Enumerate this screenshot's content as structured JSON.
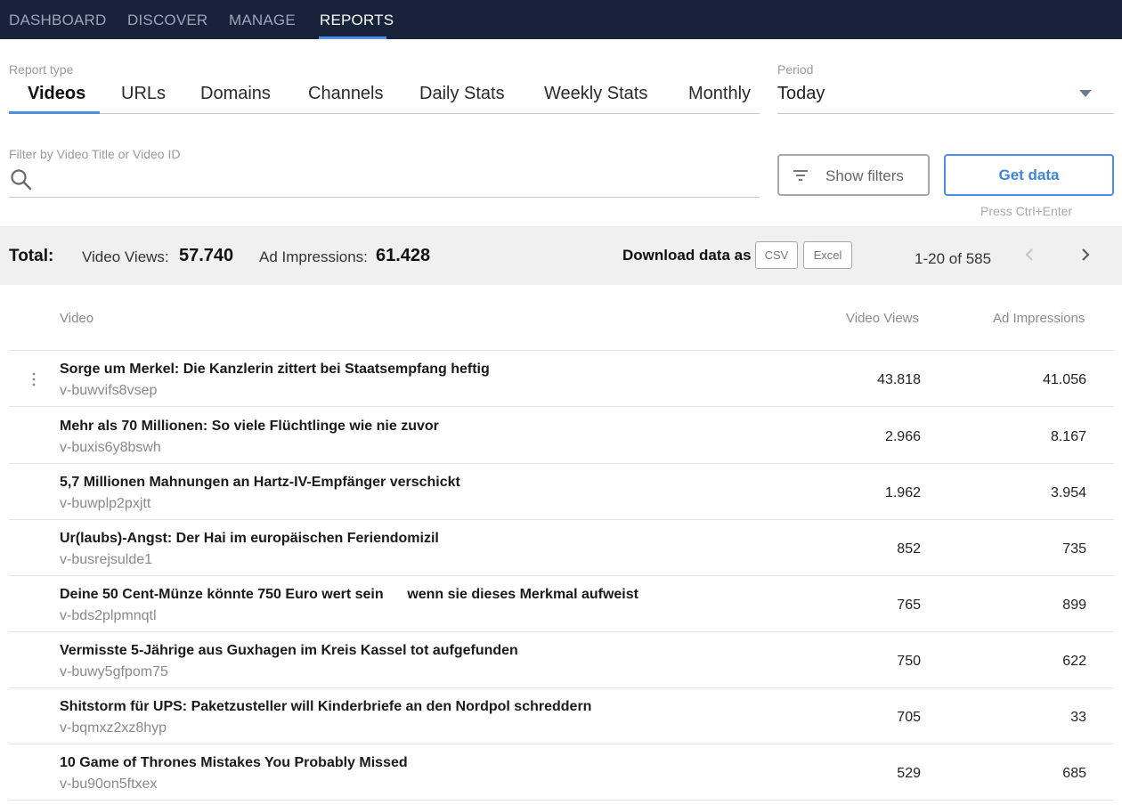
{
  "nav": {
    "items": [
      {
        "label": "DASHBOARD"
      },
      {
        "label": "DISCOVER"
      },
      {
        "label": "MANAGE"
      },
      {
        "label": "REPORTS"
      }
    ],
    "active": "REPORTS",
    "background": "#16233a",
    "accent": "#4a90e2"
  },
  "report_type": {
    "label": "Report type",
    "tabs": [
      {
        "label": "Videos"
      },
      {
        "label": "URLs"
      },
      {
        "label": "Domains"
      },
      {
        "label": "Channels"
      },
      {
        "label": "Daily Stats"
      },
      {
        "label": "Weekly Stats"
      },
      {
        "label": "Monthly"
      }
    ],
    "active": "Videos"
  },
  "period": {
    "label": "Period",
    "value": "Today"
  },
  "filter": {
    "label": "Filter by Video Title or Video ID",
    "value": "",
    "icon": "search-icon"
  },
  "actions": {
    "show_filters": "Show filters",
    "get_data": "Get data",
    "hint": "Press Ctrl+Enter"
  },
  "totals": {
    "label": "Total:",
    "views_label": "Video Views:",
    "views_value": "57.740",
    "imps_label": "Ad Impressions:",
    "imps_value": "61.428",
    "download_label": "Download data as",
    "csv": "CSV",
    "excel": "Excel",
    "pager_range": "1-20",
    "pager_of": "of",
    "pager_total": "585"
  },
  "table": {
    "columns": {
      "video": "Video",
      "views": "Video Views",
      "imps": "Ad Impressions"
    },
    "rows": [
      {
        "title": "Sorge um Merkel: Die Kanzlerin zittert bei Staatsempfang heftig",
        "id": "v-buwvifs8vsep",
        "views": "43.818",
        "imps": "41.056"
      },
      {
        "title": "Mehr als 70 Millionen: So viele Flüchtlinge wie nie zuvor",
        "id": "v-buxis6y8bswh",
        "views": "2.966",
        "imps": "8.167"
      },
      {
        "title": "5,7 Millionen Mahnungen an Hartz-IV-Empfänger verschickt",
        "id": "v-buwplp2pxjtt",
        "views": "1.962",
        "imps": "3.954"
      },
      {
        "title": "Ur(laubs)-Angst: Der Hai im europäischen Feriendomizil",
        "id": "v-busrejsulde1",
        "views": "852",
        "imps": "735"
      },
      {
        "title": "Deine 50 Cent-Münze könnte 750 Euro wert sein      wenn sie dieses Merkmal aufweist",
        "id": "v-bds2plpmnqtl",
        "views": "765",
        "imps": "899"
      },
      {
        "title": "Vermisste 5-Jährige aus Guxhagen im Kreis Kassel tot aufgefunden",
        "id": "v-buwy5gfpom75",
        "views": "750",
        "imps": "622"
      },
      {
        "title": "Shitstorm für UPS: Paketzusteller will Kinderbriefe an den Nordpol schreddern",
        "id": "v-bqmxz2xz8hyp",
        "views": "705",
        "imps": "33"
      },
      {
        "title": "10 Game of Thrones Mistakes You Probably Missed",
        "id": "v-bu90on5ftxex",
        "views": "529",
        "imps": "685"
      }
    ]
  }
}
